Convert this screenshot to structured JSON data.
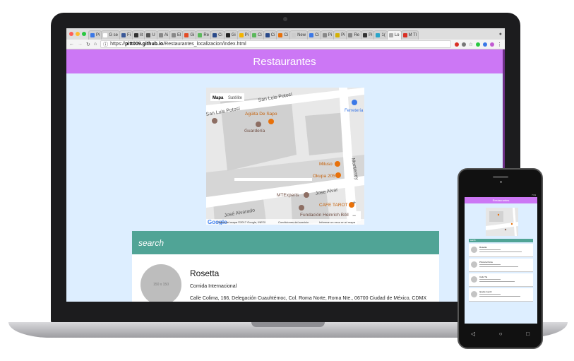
{
  "browser": {
    "tabs": [
      {
        "label": "Pi",
        "color": "#3b78e7"
      },
      {
        "label": "G se",
        "color": "#ffffff"
      },
      {
        "label": "Fi",
        "color": "#3b5998"
      },
      {
        "label": "lit",
        "color": "#333333"
      },
      {
        "label": "U",
        "color": "#555555"
      },
      {
        "label": "Ai",
        "color": "#888888"
      },
      {
        "label": "El",
        "color": "#888888"
      },
      {
        "label": "Gi",
        "color": "#e34c26"
      },
      {
        "label": "Re",
        "color": "#5cb85c"
      },
      {
        "label": "Ci",
        "color": "#2a4a8a"
      },
      {
        "label": "Gi",
        "color": "#222222"
      },
      {
        "label": "Pi",
        "color": "#f4b400"
      },
      {
        "label": "Ci",
        "color": "#5cb85c"
      },
      {
        "label": "Ci",
        "color": "#2a4a8a"
      },
      {
        "label": "Ci",
        "color": "#e8710a"
      },
      {
        "label": "New",
        "color": "#cccccc"
      },
      {
        "label": "Ci",
        "color": "#3b78e7"
      },
      {
        "label": "Pi",
        "color": "#888888"
      },
      {
        "label": "Pi",
        "color": "#d4b106"
      },
      {
        "label": "Re",
        "color": "#888888"
      },
      {
        "label": "Pi",
        "color": "#333333"
      },
      {
        "label": "1(",
        "color": "#2aa5c9"
      },
      {
        "label": "Lo",
        "color": "#aaaaaa",
        "active": true
      },
      {
        "label": "M Tl",
        "color": "#d93025"
      }
    ],
    "url_prefix": "https://",
    "url_host": "pitt009.github.io",
    "url_path": "/Restaurantes_localizacion/index.html"
  },
  "page": {
    "title": "Restaurantes",
    "search_placeholder": "search"
  },
  "map": {
    "map_tab": "Mapa",
    "satellite_tab": "Satélite",
    "streets": [
      "San Luis Potosí",
      "San Luis Potosí",
      "José Alvarado",
      "Jose Alvar",
      "Monterrey"
    ],
    "places": [
      "Agüita De Sapo",
      "Guardería",
      "Ferretería",
      "Miluso",
      "Okupa 205",
      "MTExperts",
      "CAFE TAROT",
      "Fundación Heinrich Böll"
    ],
    "google_logo": "Google",
    "attribution": "Datos del mapa ©2017 Google, INEGI",
    "terms": "Condiciones del servicio",
    "report": "Informar un error en el mapa",
    "zoom_in": "+",
    "zoom_out": "−"
  },
  "restaurant": {
    "avatar_placeholder": "150 x 150",
    "name": "Rosetta",
    "type": "Comida Internacional",
    "address": "Calle Colima, 166, Delegación Cuauhtémoc, Col. Roma Norte, Roma Nte., 06700 Ciudad de México, CDMX"
  },
  "phone": {
    "header_title": "Restaurantes",
    "search_placeholder": "search",
    "status_time": "7:01",
    "cards": [
      {
        "name": "Rosetta"
      },
      {
        "name": "Pizzeria Porta"
      },
      {
        "name": "Cafe Tia"
      },
      {
        "name": "Quelle Gentil"
      }
    ]
  },
  "colors": {
    "header": "#cc77f5",
    "search": "#50a496",
    "page_bg": "#ddeeff"
  }
}
